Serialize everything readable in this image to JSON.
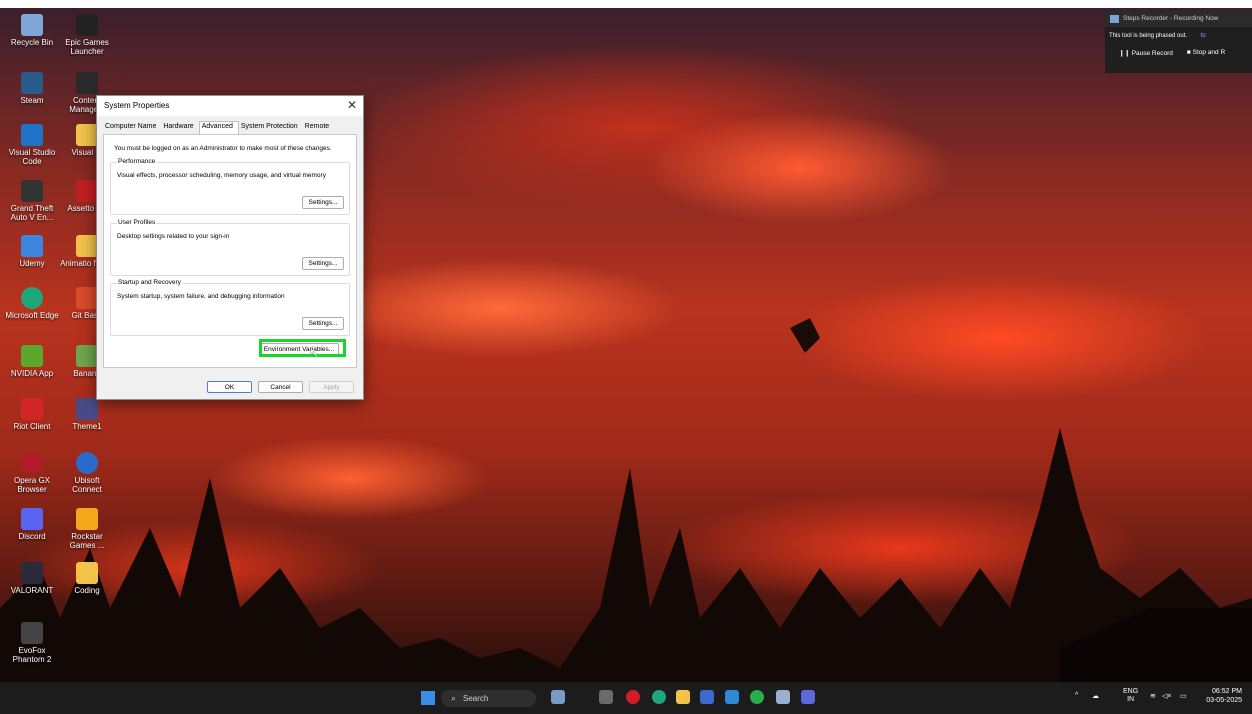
{
  "desktop": {
    "icons": [
      {
        "label": "Recycle Bin",
        "color": "#7fa6d8"
      },
      {
        "label": "Epic Games Launcher",
        "color": "#222222"
      },
      {
        "label": "Steam",
        "color": "#2a5a8a"
      },
      {
        "label": "Content Manage...",
        "color": "#2a2a2a"
      },
      {
        "label": "Visual Studio Code",
        "color": "#1e73c8"
      },
      {
        "label": "Visual pr",
        "color": "#f2c24a"
      },
      {
        "label": "Grand Theft Auto V En...",
        "color": "#333333"
      },
      {
        "label": "Assetto Co",
        "color": "#c02020"
      },
      {
        "label": "Udemy",
        "color": "#3d86e0"
      },
      {
        "label": "Animatio frame",
        "color": "#f2c24a"
      },
      {
        "label": "Microsoft Edge",
        "color": "#1fa67a"
      },
      {
        "label": "Git Bash",
        "color": "#d94b2a"
      },
      {
        "label": "NVIDIA App",
        "color": "#5aa82a"
      },
      {
        "label": "Banana",
        "color": "#6fa44a"
      },
      {
        "label": "Riot Client",
        "color": "#d1252a"
      },
      {
        "label": "Theme1",
        "color": "#4a4a8a"
      },
      {
        "label": "Opera GX Browser",
        "color": "#b21a2a"
      },
      {
        "label": "Ubisoft Connect",
        "color": "#2a6ac8"
      },
      {
        "label": "Discord",
        "color": "#5865f2"
      },
      {
        "label": "Rockstar Games ...",
        "color": "#f2a81a"
      },
      {
        "label": "VALORANT",
        "color": "#2a2a3a"
      },
      {
        "label": "Coding",
        "color": "#f2c24a"
      },
      {
        "label": "EvoFox Phantom 2",
        "color": "#444444"
      }
    ]
  },
  "dialog": {
    "title": "System Properties",
    "close_glyph": "✕",
    "tabs": [
      "Computer Name",
      "Hardware",
      "Advanced",
      "System Protection",
      "Remote"
    ],
    "admin_note": "You must be logged on as an Administrator to make most of these changes.",
    "groups": [
      {
        "title": "Performance",
        "description": "Visual effects, processor scheduling, memory usage, and virtual memory",
        "button": "Settings..."
      },
      {
        "title": "User Profiles",
        "description": "Desktop settings related to your sign-in",
        "button": "Settings..."
      },
      {
        "title": "Startup and Recovery",
        "description": "System startup, system failure, and debugging information",
        "button": "Settings..."
      }
    ],
    "env_button": "Environment Variables...",
    "ok": "OK",
    "cancel": "Cancel",
    "apply": "Apply"
  },
  "recorder": {
    "title": "Steps Recorder - Recording Now",
    "note": "This tool is being phased out.",
    "note_link": "to",
    "pause": "❙❙  Pause Record",
    "stop": "■  Stop and R"
  },
  "taskbar": {
    "search": "Search",
    "lang_top": "ENG",
    "lang_bottom": "IN",
    "time": "06:52 PM",
    "date": "03-05-2025"
  }
}
